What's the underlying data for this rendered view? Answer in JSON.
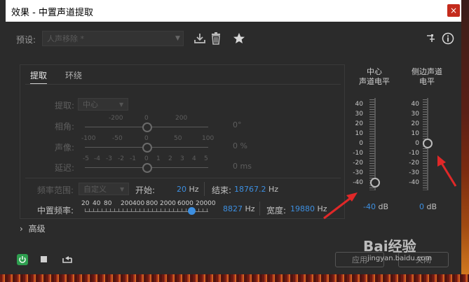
{
  "window": {
    "title": "效果 - 中置声道提取",
    "close_glyph": "×"
  },
  "preset": {
    "label": "预设:",
    "value": "人声移除 *"
  },
  "tabs": [
    "提取",
    "环绕"
  ],
  "extract": {
    "label": "提取:",
    "value": "中心"
  },
  "phase": {
    "label": "相角:",
    "ticks": [
      "-200",
      "0",
      "200"
    ],
    "value": "0°"
  },
  "pan": {
    "label": "声像:",
    "ticks": [
      "-100",
      "-50",
      "0",
      "50",
      "100"
    ],
    "value": "0 %"
  },
  "delay": {
    "label": "延迟:",
    "ticks": [
      "-5",
      "-4",
      "-3",
      "-2",
      "-1",
      "0",
      "1",
      "2",
      "3",
      "4",
      "5"
    ],
    "value": "0 ms"
  },
  "freq_range": {
    "label": "频率范围:",
    "value": "自定义",
    "start_label": "开始:",
    "start_value": "20",
    "start_unit": "Hz",
    "end_label": "结束:",
    "end_value": "18767.2",
    "end_unit": "Hz"
  },
  "center_freq": {
    "label": "中置频率:",
    "ticks": [
      "20",
      "40",
      "80",
      "200",
      "400",
      "800",
      "2000",
      "6000",
      "20000"
    ],
    "value": "8827",
    "unit": "Hz",
    "width_label": "宽度:",
    "width_value": "19880",
    "width_unit": "Hz"
  },
  "advanced": {
    "label": "高级"
  },
  "meters": {
    "scale": [
      "40",
      "30",
      "20",
      "10",
      "0",
      "-10",
      "-20",
      "-30",
      "-40"
    ],
    "center": {
      "title_line1": "中心",
      "title_line2": "声道电平",
      "value": "-40",
      "unit": "dB"
    },
    "side": {
      "title_line1": "侧边声道",
      "title_line2": "电平",
      "value": "0",
      "unit": "dB"
    }
  },
  "footer": {
    "apply": "应用",
    "close": "关闭"
  },
  "watermark": {
    "text": "Bai经验",
    "url": "jingyan.baidu.com"
  },
  "colors": {
    "accent": "#3d8fe0",
    "power": "#2e9e4f",
    "arrow": "#e02828",
    "close": "#c42b1c"
  }
}
